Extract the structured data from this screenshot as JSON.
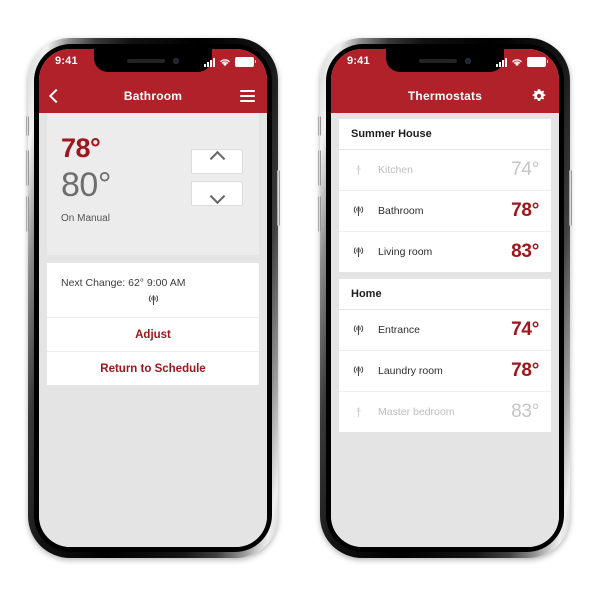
{
  "status_bar": {
    "time": "9:41",
    "signal_icon": "cellular-bars-icon",
    "wifi_icon": "wifi-icon",
    "battery_icon": "battery-full-icon"
  },
  "phone_left": {
    "nav": {
      "back_icon": "chevron-left-icon",
      "title": "Bathroom",
      "menu_icon": "hamburger-menu-icon"
    },
    "thermostat": {
      "current_temperature": "78°",
      "target_temperature": "80°",
      "mode": "On Manual",
      "increase_icon": "chevron-up-icon",
      "decrease_icon": "chevron-down-icon"
    },
    "next_change": {
      "text": "Next Change: 62° 9:00 AM",
      "signal_icon": "antenna-signal-icon"
    },
    "actions": [
      {
        "label": "Adjust",
        "name": "adjust-button"
      },
      {
        "label": "Return to Schedule",
        "name": "return-to-schedule-button"
      }
    ]
  },
  "phone_right": {
    "nav": {
      "title": "Thermostats",
      "settings_icon": "gear-icon"
    },
    "sections": [
      {
        "title": "Summer House",
        "rows": [
          {
            "name": "Kitchen",
            "temperature": "74°",
            "online": false,
            "icon": "antenna-offline-icon"
          },
          {
            "name": "Bathroom",
            "temperature": "78°",
            "online": true,
            "icon": "antenna-signal-icon"
          },
          {
            "name": "Living room",
            "temperature": "83°",
            "online": true,
            "icon": "antenna-signal-icon"
          }
        ]
      },
      {
        "title": "Home",
        "rows": [
          {
            "name": "Entrance",
            "temperature": "74°",
            "online": true,
            "icon": "antenna-signal-icon"
          },
          {
            "name": "Laundry room",
            "temperature": "78°",
            "online": true,
            "icon": "antenna-signal-icon"
          },
          {
            "name": "Master bedroom",
            "temperature": "83°",
            "online": false,
            "icon": "antenna-offline-icon"
          }
        ]
      }
    ]
  },
  "colors": {
    "brand_red": "#B0212A",
    "text_red": "#A0161C",
    "target_grey": "#6e6e6e",
    "disabled_grey": "#c4c4c4",
    "screen_bg": "#e4e4e4"
  }
}
